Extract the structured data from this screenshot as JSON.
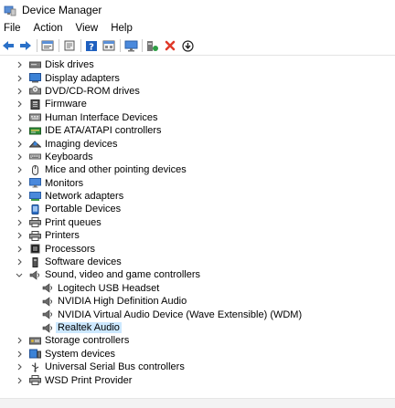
{
  "window": {
    "title": "Device Manager"
  },
  "menu": {
    "items": [
      "File",
      "Action",
      "View",
      "Help"
    ]
  },
  "toolbar": {
    "buttons": [
      {
        "name": "back-arrow-icon"
      },
      {
        "name": "forward-arrow-icon"
      },
      {
        "name": "properties-icon"
      },
      {
        "name": "update-driver-icon"
      },
      {
        "name": "help-icon"
      },
      {
        "name": "view-list-icon"
      },
      {
        "name": "monitor-icon"
      },
      {
        "name": "scan-hardware-icon"
      },
      {
        "name": "uninstall-x-icon"
      },
      {
        "name": "download-icon"
      }
    ]
  },
  "tree": {
    "categories": [
      {
        "label": "Disk drives",
        "icon": "disk-drive-icon",
        "expanded": false
      },
      {
        "label": "Display adapters",
        "icon": "display-adapter-icon",
        "expanded": false
      },
      {
        "label": "DVD/CD-ROM drives",
        "icon": "dvd-drive-icon",
        "expanded": false
      },
      {
        "label": "Firmware",
        "icon": "firmware-icon",
        "expanded": false
      },
      {
        "label": "Human Interface Devices",
        "icon": "hid-icon",
        "expanded": false
      },
      {
        "label": "IDE ATA/ATAPI controllers",
        "icon": "ide-controller-icon",
        "expanded": false
      },
      {
        "label": "Imaging devices",
        "icon": "camera-icon",
        "expanded": false
      },
      {
        "label": "Keyboards",
        "icon": "keyboard-icon",
        "expanded": false
      },
      {
        "label": "Mice and other pointing devices",
        "icon": "mouse-icon",
        "expanded": false
      },
      {
        "label": "Monitors",
        "icon": "monitor-icon",
        "expanded": false
      },
      {
        "label": "Network adapters",
        "icon": "network-adapter-icon",
        "expanded": false
      },
      {
        "label": "Portable Devices",
        "icon": "portable-device-icon",
        "expanded": false
      },
      {
        "label": "Print queues",
        "icon": "printer-icon",
        "expanded": false
      },
      {
        "label": "Printers",
        "icon": "printer-icon",
        "expanded": false
      },
      {
        "label": "Processors",
        "icon": "processor-icon",
        "expanded": false
      },
      {
        "label": "Software devices",
        "icon": "software-device-icon",
        "expanded": false
      },
      {
        "label": "Sound, video and game controllers",
        "icon": "speaker-icon",
        "expanded": true,
        "children": [
          {
            "label": "Logitech USB Headset",
            "icon": "speaker-icon",
            "selected": false
          },
          {
            "label": "NVIDIA High Definition Audio",
            "icon": "speaker-icon",
            "selected": false
          },
          {
            "label": "NVIDIA Virtual Audio Device (Wave Extensible) (WDM)",
            "icon": "speaker-icon",
            "selected": false
          },
          {
            "label": "Realtek Audio",
            "icon": "speaker-icon",
            "selected": true
          }
        ]
      },
      {
        "label": "Storage controllers",
        "icon": "storage-controller-icon",
        "expanded": false
      },
      {
        "label": "System devices",
        "icon": "system-device-icon",
        "expanded": false
      },
      {
        "label": "Universal Serial Bus controllers",
        "icon": "usb-icon",
        "expanded": false
      },
      {
        "label": "WSD Print Provider",
        "icon": "printer-icon",
        "expanded": false
      }
    ]
  },
  "colors": {
    "selection": "#cce8ff",
    "accent": "#1e6fd9",
    "delete": "#e03a2a"
  }
}
